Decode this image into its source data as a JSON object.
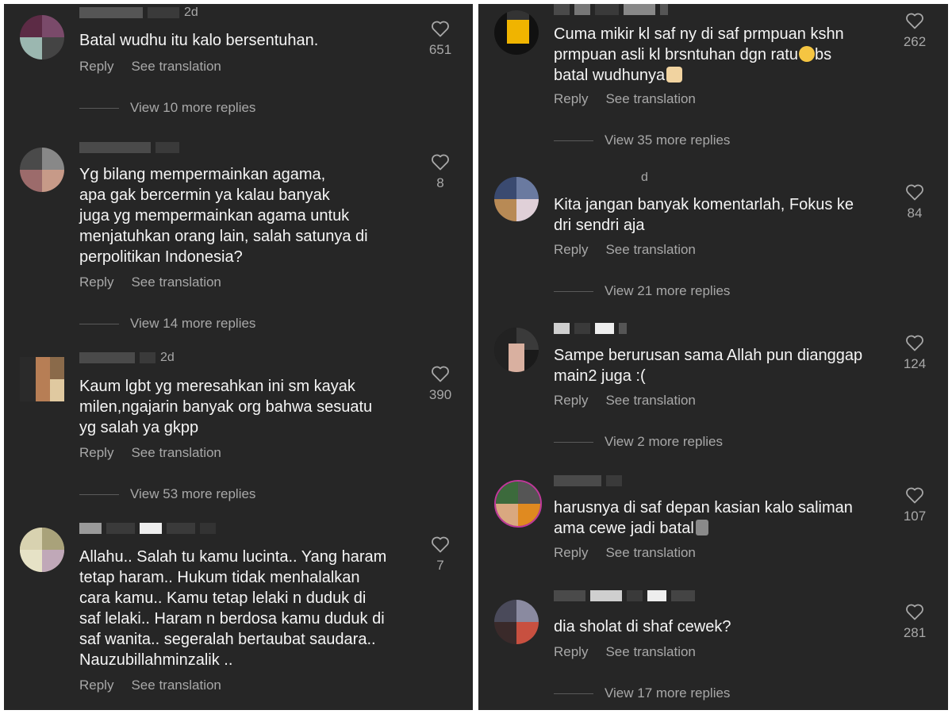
{
  "ui": {
    "reply_label": "Reply",
    "translate_label": "See translation"
  },
  "left": [
    {
      "meta": "2d",
      "text": "Batal wudhu itu kalo bersentuhan.",
      "likes": "651",
      "more": "View 10 more replies"
    },
    {
      "meta": "",
      "text": "Yg bilang mempermainkan agama,\napa gak bercermin ya kalau banyak\njuga yg mempermainkan agama untuk\nmenjatuhkan orang lain, salah satunya di\nperpolitikan Indonesia?",
      "likes": "8",
      "more": "View 14 more replies"
    },
    {
      "meta": "2d",
      "text": "Kaum lgbt yg meresahkan ini sm kayak\nmilen,ngajarin banyak org bahwa sesuatu\nyg salah ya gkpp",
      "likes": "390",
      "more": "View 53 more replies"
    },
    {
      "meta": "",
      "text": "Allahu.. Salah tu kamu lucinta.. Yang haram\ntetap haram.. Hukum tidak menhalalkan\ncara kamu.. Kamu tetap lelaki n duduk di\nsaf lelaki.. Haram n berdosa kamu duduk di\nsaf wanita.. segeralah bertaubat saudara..\nNauzubillahminzalik ..",
      "likes": "7",
      "more": ""
    }
  ],
  "right": [
    {
      "meta": "",
      "text1": "Cuma mikir kl saf ny di saf prmpuan kshn\nprmpuan asli kl brsntuhan dgn ratu",
      "text2": "bs\nbatal wudhunya",
      "likes": "262",
      "more": "View 35 more replies"
    },
    {
      "meta": "d",
      "text": "Kita jangan banyak komentarlah, Fokus ke\ndri sendri aja",
      "likes": "84",
      "more": "View 21 more replies"
    },
    {
      "meta": "",
      "text": "Sampe berurusan sama Allah pun dianggap\nmain2 juga :(",
      "likes": "124",
      "more": "View 2 more replies"
    },
    {
      "meta": "",
      "text": "harusnya di saf depan kasian kalo saliman\nama cewe jadi batal",
      "likes": "107",
      "more": ""
    },
    {
      "meta": "",
      "text": "dia sholat di shaf cewek?",
      "likes": "281",
      "more": "View 17 more replies"
    }
  ],
  "icons": {
    "like": "heart-outline-icon",
    "emoji_sad": "crying-face-emoji",
    "emoji_pray": "folded-hands-emoji",
    "emoji_moai": "moai-emoji"
  },
  "colors": {
    "background": "#262626",
    "text": "#f5f5f5",
    "muted": "#a8a8a8"
  }
}
